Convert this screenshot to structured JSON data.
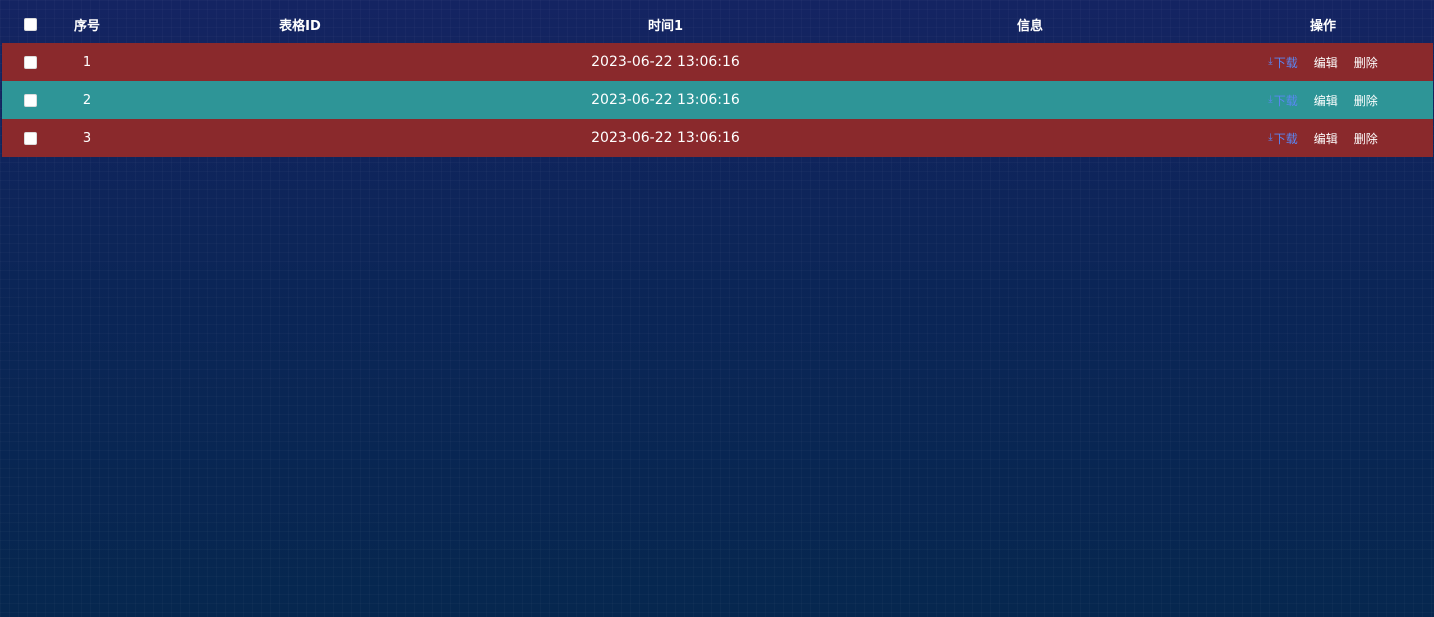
{
  "table": {
    "columns": [
      "序号",
      "表格ID",
      "时间1",
      "信息",
      "操作"
    ],
    "rows": [
      {
        "index": "1",
        "table_id": "",
        "time": "2023-06-22 13:06:16",
        "info": "",
        "color": "#8a292c"
      },
      {
        "index": "2",
        "table_id": "",
        "time": "2023-06-22 13:06:16",
        "info": "",
        "color": "#2e9597"
      },
      {
        "index": "3",
        "table_id": "",
        "time": "2023-06-22 13:06:16",
        "info": "",
        "color": "#8a292c"
      }
    ],
    "actions": {
      "download_icon": "download-icon",
      "download_label": "下载",
      "edit_label": "编辑",
      "delete_label": "删除"
    }
  },
  "colors": {
    "background": "#0b2355",
    "row_red": "#8a292c",
    "row_teal": "#2e9597",
    "link_blue": "#5a86f2"
  }
}
